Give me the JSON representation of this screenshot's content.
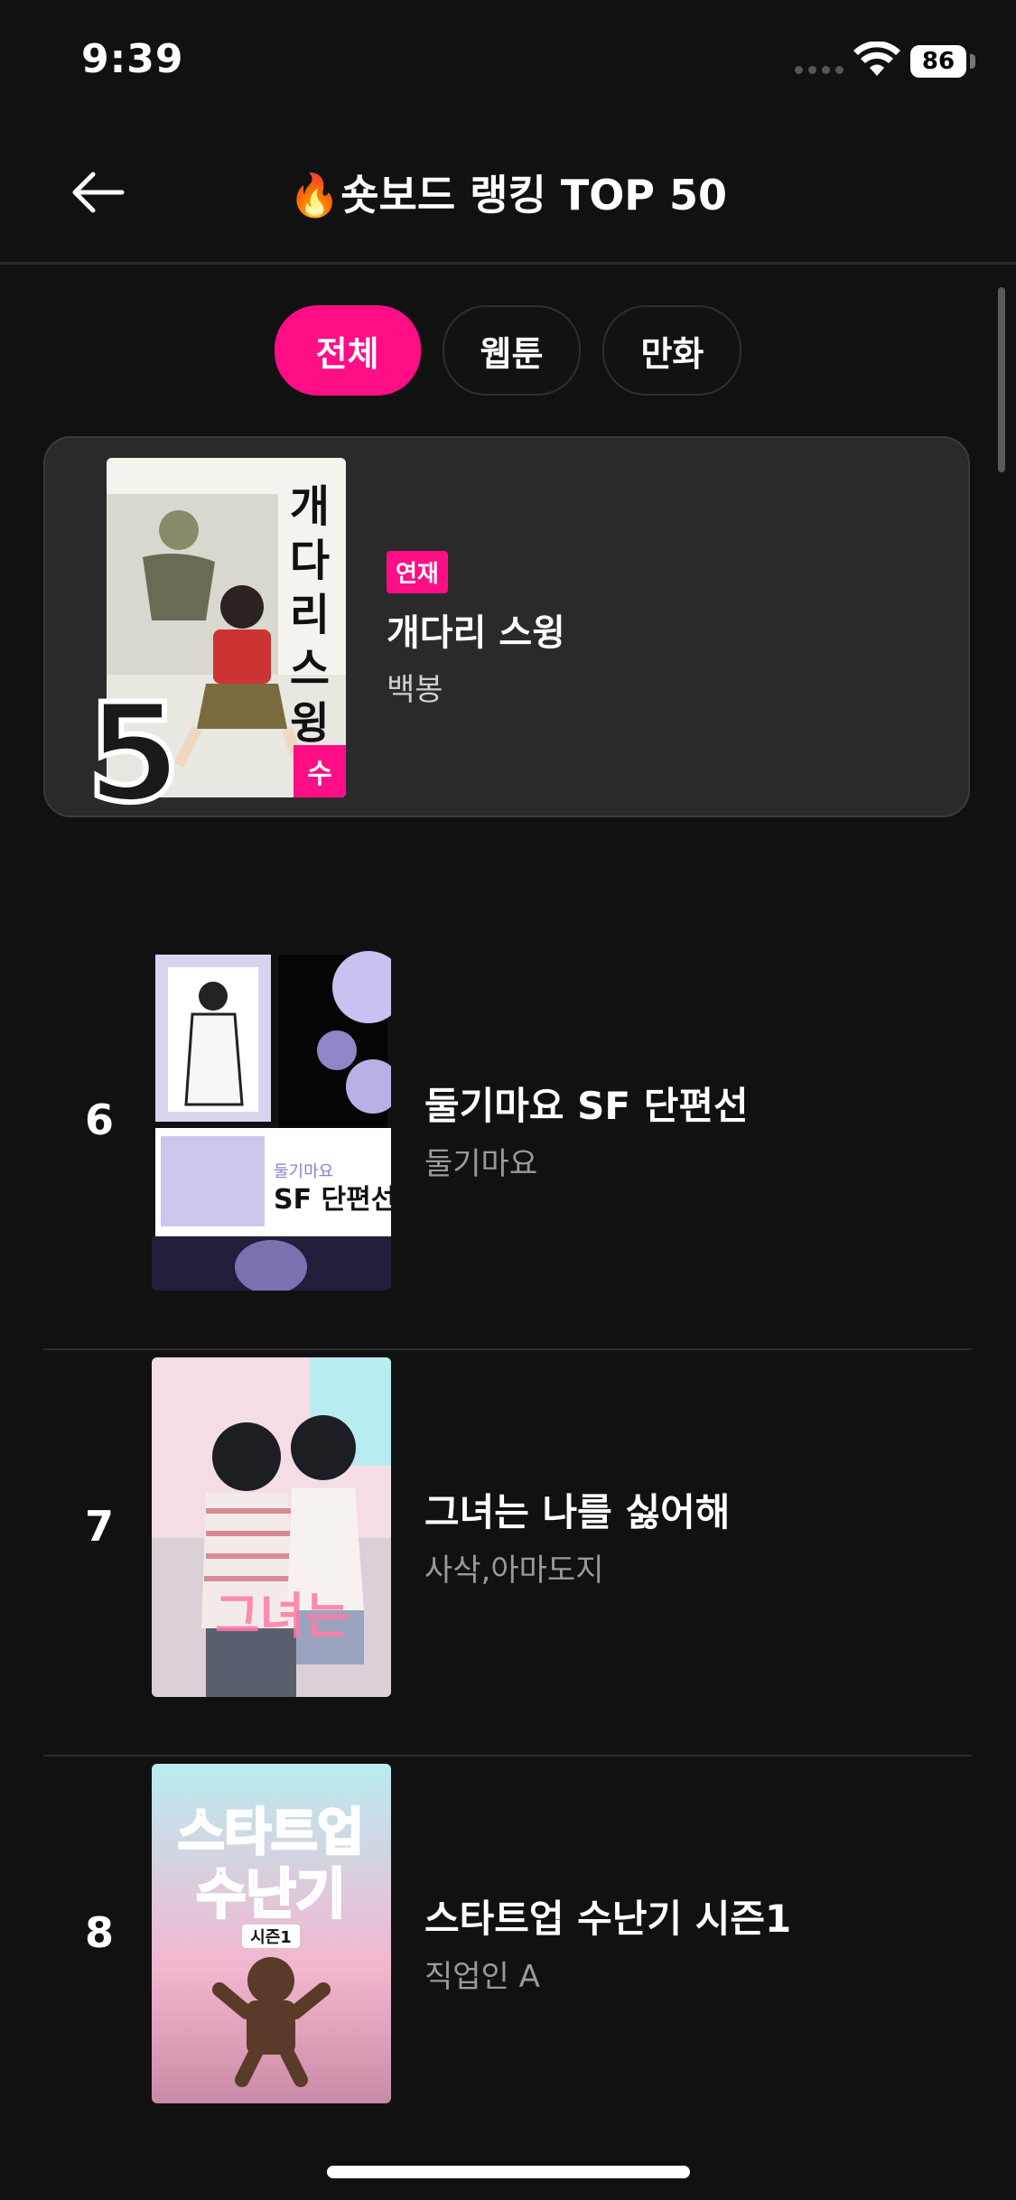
{
  "status": {
    "time": "9:39",
    "battery": "86"
  },
  "header": {
    "title": "🔥숏보드 랭킹 TOP 50",
    "back_icon": "arrow-left-icon"
  },
  "tabs": [
    {
      "label": "전체",
      "active": true
    },
    {
      "label": "웹툰",
      "active": false
    },
    {
      "label": "만화",
      "active": false
    }
  ],
  "featured": {
    "rank": "5",
    "badge": "수",
    "tag": "연재",
    "title": "개다리 스윙",
    "author": "백봉"
  },
  "list": [
    {
      "rank": "6",
      "title": "둘기마요 SF 단편선",
      "author": "둘기마요"
    },
    {
      "rank": "7",
      "title": "그녀는 나를 싫어해",
      "author": "사삭,아마도지"
    },
    {
      "rank": "8",
      "title": "스타트업 수난기 시즌1",
      "author": "직업인 A"
    }
  ],
  "colors": {
    "accent": "#ff0e86",
    "background": "#111112"
  }
}
